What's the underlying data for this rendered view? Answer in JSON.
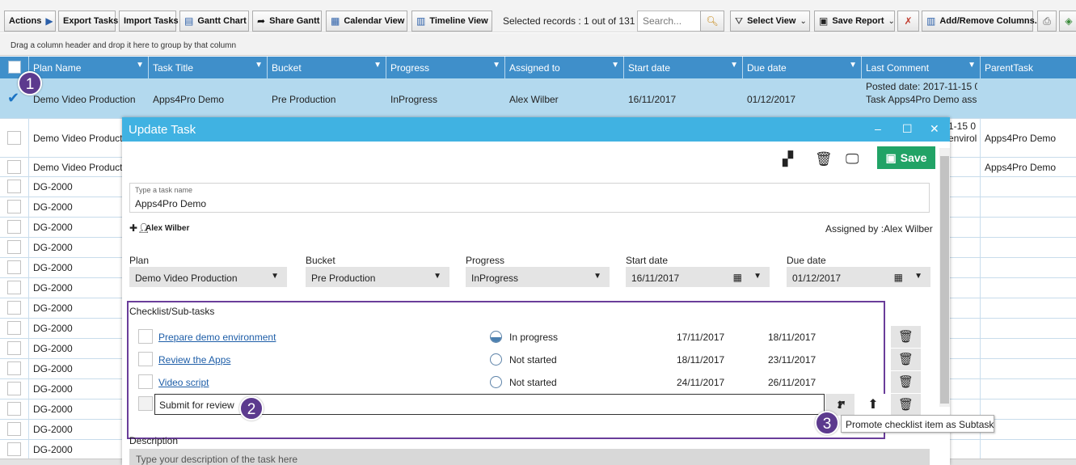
{
  "toolbar": {
    "actions_label": "Actions",
    "export_label": "Export Tasks",
    "import_label": "Import Tasks",
    "gantt_label": "Gantt Chart",
    "share_gantt_label": "Share Gantt",
    "calendar_label": "Calendar View",
    "timeline_label": "Timeline View",
    "selected_records": "Selected records : 1 out of 131",
    "search_placeholder": "Search...",
    "select_view_label": "Select View",
    "save_report_label": "Save Report",
    "add_remove_columns_label": "Add/Remove Columns.."
  },
  "group_hint": "Drag a column header and drop it here to group by that column",
  "grid": {
    "columns": [
      "Plan Name",
      "Task Title",
      "Bucket",
      "Progress",
      "Assigned to",
      "Start date",
      "Due date",
      "Last Comment",
      "ParentTask"
    ],
    "selected_row": {
      "plan": "Demo Video Production",
      "title": "Apps4Pro Demo",
      "bucket": "Pre Production",
      "progress": "InProgress",
      "assigned": "Alex Wilber",
      "start": "16/11/2017",
      "due": "01/12/2017",
      "comment_line1": "Posted date: 2017-11-15 0",
      "comment_line2": "Task Apps4Pro Demo assig"
    },
    "row2": {
      "plan": "Demo Video Product",
      "comment_line1": "1-15 0",
      "comment_line2": "envirol",
      "parent": "Apps4Pro Demo"
    },
    "row3": {
      "plan": "Demo Video Product",
      "parent": "Apps4Pro Demo"
    },
    "dg_rows": [
      "DG-2000",
      "DG-2000",
      "DG-2000",
      "DG-2000",
      "DG-2000",
      "DG-2000",
      "DG-2000",
      "DG-2000",
      "DG-2000",
      "DG-2000",
      "DG-2000",
      "DG-2000",
      "DG-2000",
      "DG-2000"
    ]
  },
  "badges": [
    "1",
    "2",
    "3"
  ],
  "dialog": {
    "title": "Update Task",
    "save_label": "Save",
    "name_placeholder": "Type a task name",
    "task_name": "Apps4Pro Demo",
    "assignee": "Alex Wilber",
    "assigned_by": "Assigned by :Alex Wilber",
    "plan_label": "Plan",
    "plan_value": "Demo Video Production",
    "bucket_label": "Bucket",
    "bucket_value": "Pre Production",
    "progress_label": "Progress",
    "progress_value": "InProgress",
    "start_label": "Start date",
    "start_value": "16/11/2017",
    "due_label": "Due date",
    "due_value": "01/12/2017",
    "checklist_title": "Checklist/Sub-tasks",
    "checklist": [
      {
        "name": "Prepare demo environment",
        "status": "In progress",
        "start": "17/11/2017",
        "due": "18/11/2017"
      },
      {
        "name": "Review the Apps",
        "status": "Not started",
        "start": "18/11/2017",
        "due": "23/11/2017"
      },
      {
        "name": "Video script",
        "status": "Not started",
        "start": "24/11/2017",
        "due": "26/11/2017"
      }
    ],
    "new_item_value": "Submit for review",
    "description_label": "Description",
    "description_placeholder": "Type your description of the task here"
  },
  "tooltip": "Promote checklist item as Subtask",
  "colors": {
    "header_blue": "#3f8fca",
    "dialog_blue": "#40b2e2",
    "save_green": "#21a366",
    "badge_purple": "#5c3a8e"
  }
}
